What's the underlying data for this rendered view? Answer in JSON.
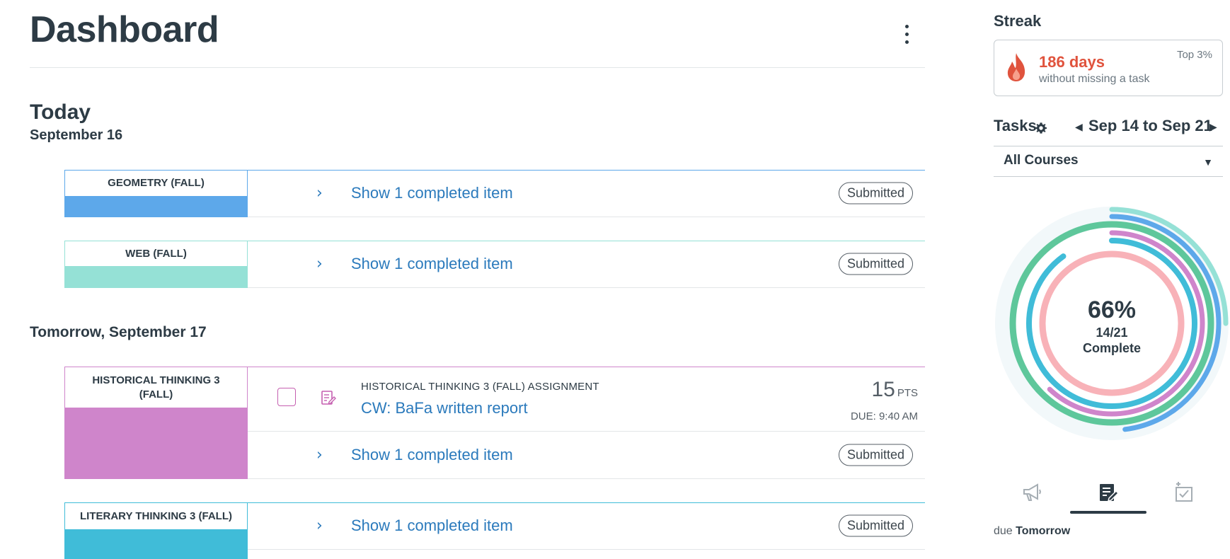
{
  "header": {
    "title": "Dashboard",
    "menu_icon": "kebab-icon"
  },
  "days": [
    {
      "title": "Today",
      "date": "September 16"
    },
    {
      "title": "Tomorrow, September 17"
    }
  ],
  "groups": [
    {
      "course": "GEOMETRY (FALL)",
      "color": "#5da8ea",
      "text_color": "#2b7abc",
      "completed": "Show 1 completed item",
      "status": "Submitted"
    },
    {
      "course": "WEB (FALL)",
      "color": "#95e1d6",
      "text_color": "#2b7abc",
      "completed": "Show 1 completed item",
      "status": "Submitted"
    },
    {
      "course": "HISTORICAL THINKING 3 (FALL)",
      "color": "#cf85cb",
      "text_color": "#2b7abc",
      "assignment": {
        "type": "HISTORICAL THINKING 3 (FALL) ASSIGNMENT",
        "title": "CW: BaFa written report",
        "points": "15",
        "points_label": "PTS",
        "due": "DUE: 9:40 AM",
        "icon": "assignment-icon"
      },
      "completed": "Show 1 completed item",
      "status": "Submitted"
    },
    {
      "course": "LITERARY THINKING 3 (FALL)",
      "color": "#40bcd8",
      "text_color": "#2b7abc",
      "completed": "Show 1 completed item",
      "status": "Submitted"
    }
  ],
  "sidebar": {
    "streak": {
      "heading": "Streak",
      "days": "186 days",
      "subtitle": "without missing a task",
      "rank": "Top 3%",
      "icon": "flame-icon"
    },
    "tasks": {
      "heading": "Tasks",
      "range": "Sep 14 to Sep 21",
      "filter": "All Courses"
    },
    "progress": {
      "percent": "66%",
      "fraction": "14/21",
      "label": "Complete",
      "rings": [
        {
          "color": "#95e1d6",
          "fraction": 0.25
        },
        {
          "color": "#5da8ea",
          "fraction": 0.48
        },
        {
          "color": "#5ec79b",
          "fraction": 1.0
        },
        {
          "color": "#cf85cb",
          "fraction": 0.62
        },
        {
          "color": "#40bcd8",
          "fraction": 0.9
        },
        {
          "color": "#f8b2b8",
          "fraction": 1.0
        }
      ]
    },
    "tabs": [
      {
        "name": "announcements-icon"
      },
      {
        "name": "assignments-icon",
        "active": true
      },
      {
        "name": "todo-add-icon"
      }
    ],
    "due": {
      "prefix": "due",
      "when": "Tomorrow"
    }
  },
  "colors": {
    "link": "#2b7abc",
    "text": "#2d3b45",
    "streak": "#e0533d"
  }
}
